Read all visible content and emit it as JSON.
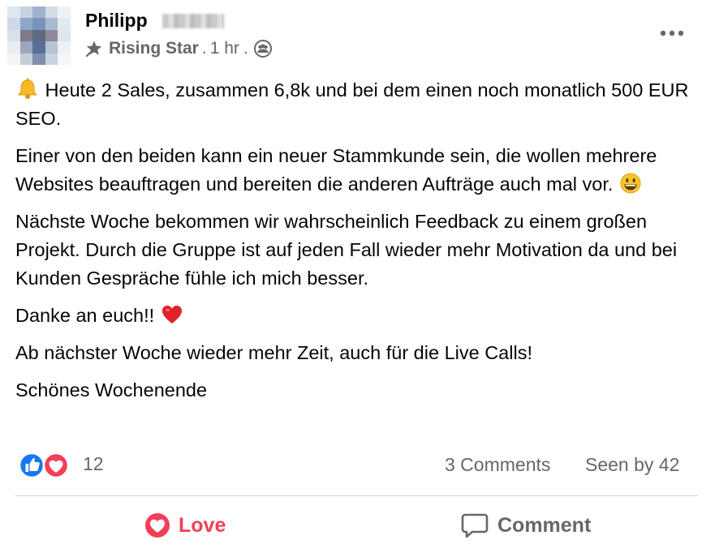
{
  "post": {
    "author_name": "Philipp",
    "badge_label": "Rising Star",
    "time_sep_1": ".",
    "time": "1 hr",
    "time_sep_2": ".",
    "paragraphs": {
      "p1": "Heute 2 Sales, zusammen 6,8k und bei dem einen noch monatlich 500 EUR SEO.",
      "p2": "Einer von den beiden kann ein neuer Stammkunde sein, die wollen mehrere Websites beauftragen und bereiten die anderen Aufträge auch mal vor.",
      "p3": "Nächste Woche bekommen wir wahrscheinlich Feedback zu einem großen Projekt. Durch die Gruppe ist auf jeden Fall wieder mehr Motivation da und bei Kunden Gespräche fühle ich mich besser.",
      "p4": "Danke an euch!!",
      "p5": "Ab nächster Woche wieder mehr Zeit, auch für die Live Calls!",
      "p6": "Schönes Wochenende"
    },
    "icons": {
      "badge": "rising-star-badge-icon",
      "privacy": "group-members-icon",
      "more": "more-options-icon",
      "emoji_p1": "bell-emoji",
      "emoji_p2": "grinning-face-emoji",
      "emoji_p4": "red-heart-emoji"
    }
  },
  "stats": {
    "reaction_count": "12",
    "comments": "3 Comments",
    "seen_by": "Seen by 42",
    "reaction_types": [
      "like",
      "love"
    ]
  },
  "actions": {
    "love_label": "Love",
    "comment_label": "Comment"
  },
  "colors": {
    "like_blue": "#1877f2",
    "love_red": "#f33e58",
    "secondary_text": "#65676b",
    "divider": "#ced0d4"
  }
}
